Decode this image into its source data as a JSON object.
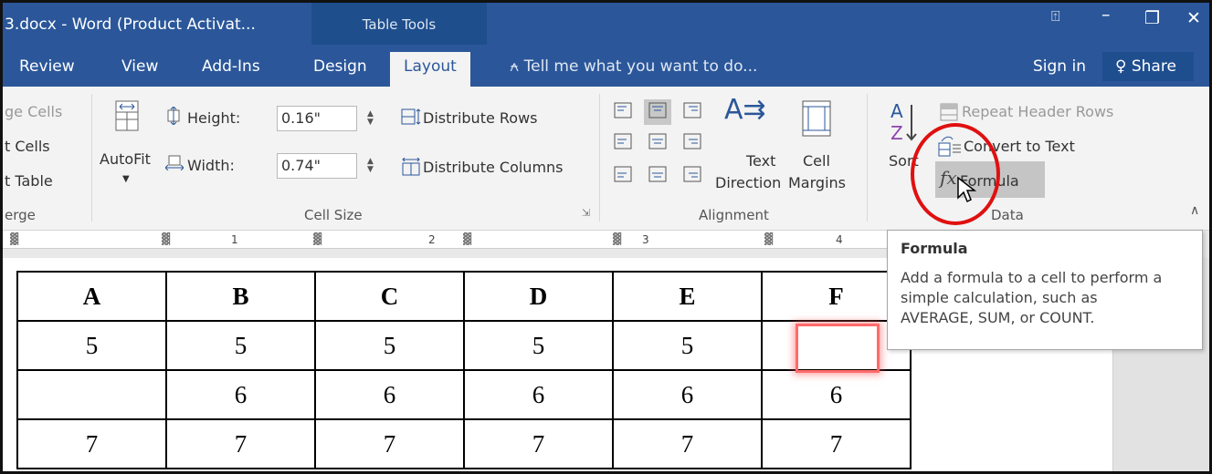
{
  "window": {
    "title": "3.docx - Word (Product Activat...",
    "context_tab": "Table Tools",
    "controls": {
      "restore": "⊟",
      "minimize": "—",
      "maximize": "🗗",
      "close": "✕"
    }
  },
  "tabs": [
    {
      "label": "Review"
    },
    {
      "label": "View"
    },
    {
      "label": "Add-Ins"
    },
    {
      "label": "Design"
    },
    {
      "label": "Layout"
    }
  ],
  "tell_me": {
    "text": "Tell me what you want to do..."
  },
  "account": {
    "sign_in": "Sign in",
    "share": "Share"
  },
  "ribbon": {
    "merge": {
      "merge_cells": "ge Cells",
      "split_cells": "t Cells",
      "split_table": "t Table",
      "label": "erge"
    },
    "cell_size": {
      "autofit": "AutoFit",
      "height_label": "Height:",
      "height_value": "0.16\"",
      "width_label": "Width:",
      "width_value": "0.74\"",
      "distribute_rows": "Distribute Rows",
      "distribute_columns": "Distribute Columns",
      "label": "Cell Size"
    },
    "alignment": {
      "text_direction_1": "Text",
      "text_direction_2": "Direction",
      "cell_margins_1": "Cell",
      "cell_margins_2": "Margins",
      "label": "Alignment"
    },
    "data": {
      "sort": "Sort",
      "repeat_header_rows": "Repeat Header Rows",
      "convert_to_text": "Convert to Text",
      "formula": "Formula",
      "label": "Data"
    }
  },
  "ruler": {
    "marks": [
      "1",
      "2",
      "3",
      "4"
    ]
  },
  "table": {
    "headers": [
      "A",
      "B",
      "C",
      "D",
      "E",
      "F"
    ],
    "rows": [
      [
        "5",
        "5",
        "5",
        "5",
        "5",
        ""
      ],
      [
        "",
        "6",
        "6",
        "6",
        "6",
        "6"
      ],
      [
        "7",
        "7",
        "7",
        "7",
        "7",
        "7"
      ]
    ]
  },
  "tooltip": {
    "title": "Formula",
    "line1": "Add a formula to a cell to perform a",
    "line2": "simple calculation, such as",
    "line3": "AVERAGE, SUM, or COUNT."
  }
}
